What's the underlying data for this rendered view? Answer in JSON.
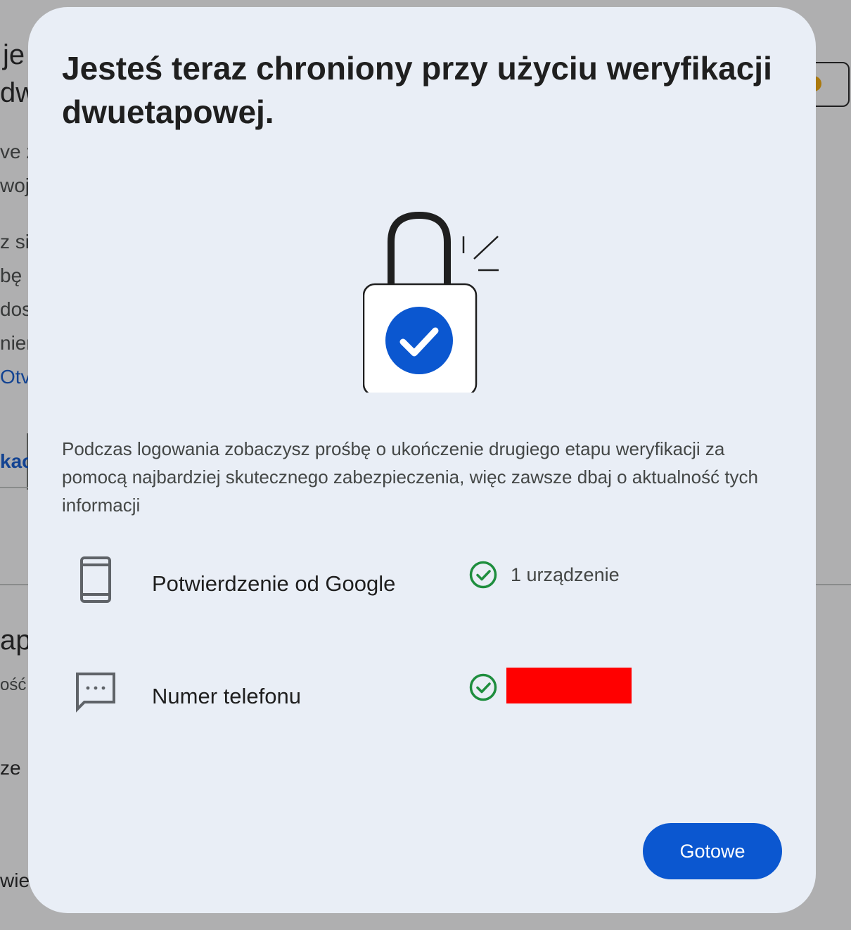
{
  "background": {
    "fragments": [
      "je",
      "dw",
      "ve z",
      "woj",
      "z się",
      "bę c",
      "dos",
      "nier",
      "Otv",
      "kac",
      "ap",
      "ość",
      "ze",
      "wier"
    ]
  },
  "dialog": {
    "title": "Jesteś teraz chroniony przy użyciu weryfikacji dwuetapowej.",
    "illustration_icon": "padlock-check-icon",
    "description": "Podczas logowania zobaczysz prośbę o ukończenie drugiego etapu weryfikacji za pomocą najbardziej skutecznego zabezpieczenia, więc zawsze dbaj o aktualność tych informacji",
    "methods": [
      {
        "icon": "smartphone-icon",
        "label": "Potwierdzenie od Google",
        "status_icon": "check-circle-icon",
        "status_text": "1 urządzenie"
      },
      {
        "icon": "sms-chat-icon",
        "label": "Numer telefonu",
        "status_icon": "check-circle-icon",
        "status_text": ""
      }
    ],
    "done_label": "Gotowe"
  },
  "colors": {
    "dialog_background": "#e9eef6",
    "accent": "#0b57d0",
    "success": "#1e8e3e",
    "redaction": "#ff0000"
  }
}
